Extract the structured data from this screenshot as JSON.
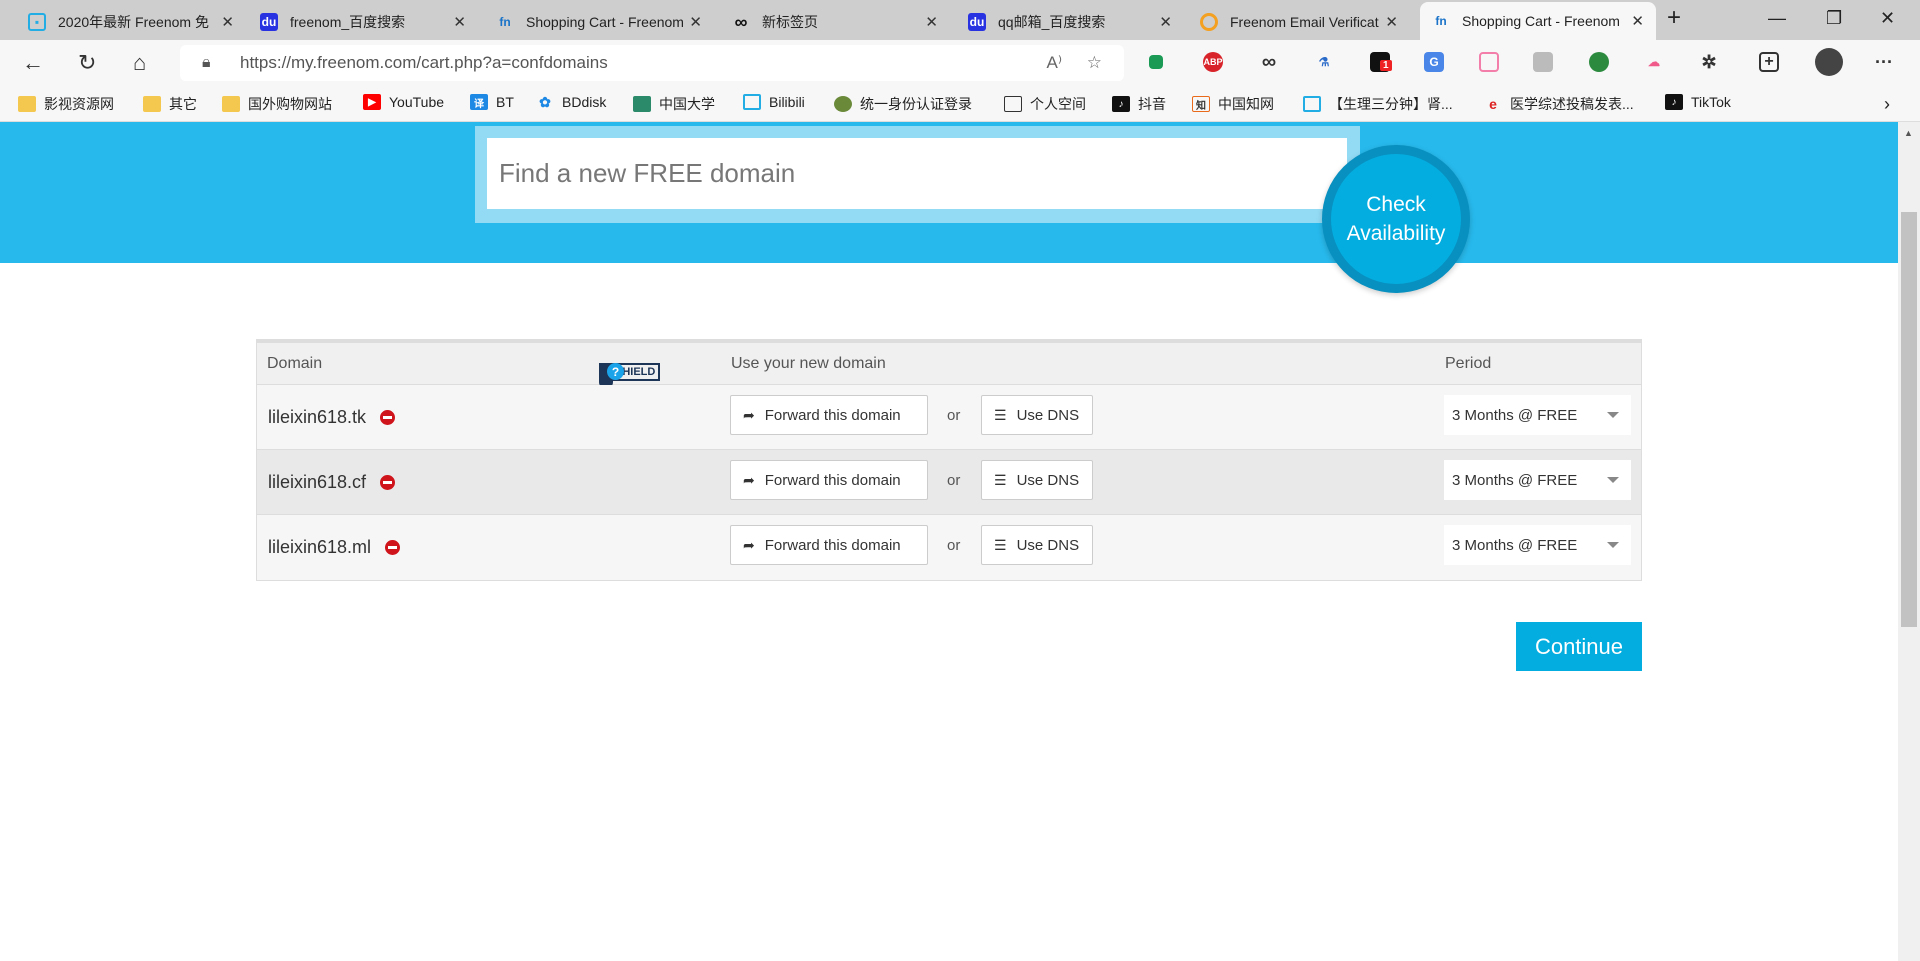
{
  "browser": {
    "tabs": [
      {
        "title": "2020年最新 Freenom 免",
        "icon": "bilibili-icon"
      },
      {
        "title": "freenom_百度搜索",
        "icon": "baidu-icon"
      },
      {
        "title": "Shopping Cart - Freenom",
        "icon": "freenom-icon"
      },
      {
        "title": "新标签页",
        "icon": "infinity-icon"
      },
      {
        "title": "qq邮箱_百度搜索",
        "icon": "baidu-icon"
      },
      {
        "title": "Freenom Email Verification",
        "icon": "chrome-icon"
      },
      {
        "title": "Shopping Cart - Freenom",
        "icon": "freenom-icon",
        "active": true
      }
    ],
    "url": "https://my.freenom.com/cart.php?a=confdomains",
    "bookmarks": [
      "影视资源网",
      "其它",
      "国外购物网站",
      "YouTube",
      "BT",
      "BDdisk",
      "中国大学",
      "Bilibili",
      "统一身份认证登录",
      "个人空间",
      "抖音",
      "中国知网",
      "【生理三分钟】肾...",
      "医学综述投稿发表...",
      "TikTok"
    ],
    "extension_badge": "1"
  },
  "search": {
    "placeholder": "Find a new FREE domain",
    "button": "Check Availability"
  },
  "table": {
    "headers": {
      "domain": "Domain",
      "idshield": "IDSHIELD",
      "use": "Use your new domain",
      "period": "Period"
    },
    "rows": [
      {
        "domain": "lileixin618.tk",
        "forward": "Forward this domain",
        "or": "or",
        "dns": "Use DNS",
        "period": "3 Months @ FREE"
      },
      {
        "domain": "lileixin618.cf",
        "forward": "Forward this domain",
        "or": "or",
        "dns": "Use DNS",
        "period": "3 Months @ FREE"
      },
      {
        "domain": "lileixin618.ml",
        "forward": "Forward this domain",
        "or": "or",
        "dns": "Use DNS",
        "period": "3 Months @ FREE"
      }
    ]
  },
  "continue": "Continue",
  "colors": {
    "brand": "#27b9ec",
    "button": "#04addf",
    "remove": "#d0141c"
  }
}
